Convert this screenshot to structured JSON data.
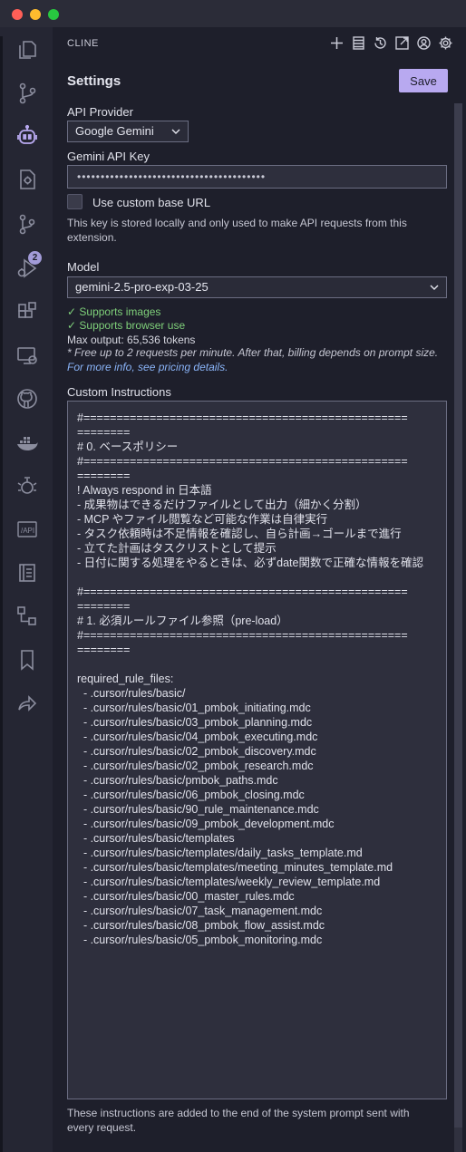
{
  "panel": {
    "view_title": "CLINE",
    "heading": "Settings",
    "save_label": "Save"
  },
  "activity_badge": "2",
  "api_provider": {
    "label": "API Provider",
    "selected": "Google Gemini"
  },
  "api_key": {
    "label": "Gemini API Key",
    "value": "••••••••••••••••••••••••••••••••••••••••"
  },
  "custom_base_url": {
    "label": "Use custom base URL",
    "checked": false
  },
  "key_note": "This key is stored locally and only used to make API requests from this extension.",
  "model": {
    "label": "Model",
    "selected": "gemini-2.5-pro-exp-03-25",
    "supports_images": "✓ Supports images",
    "supports_browser": "✓ Supports browser use",
    "max_output": "Max output: 65,536 tokens",
    "pricing_note": "* Free up to 2 requests per minute. After that, billing depends on prompt size.",
    "pricing_link": "For more info, see pricing details."
  },
  "custom_instructions": {
    "label": "Custom Instructions",
    "lines": [
      "#=================================================",
      "========",
      "# 0. ベースポリシー",
      "#=================================================",
      "========",
      "! Always respond in 日本語",
      "- 成果物はできるだけファイルとして出力（細かく分割）",
      "- MCP やファイル閲覧など可能な作業は自律実行",
      "- タスク依頼時は不足情報を確認し、自ら計画→ゴールまで進行",
      "- 立てた計画はタスクリストとして提示",
      "- 日付に関する処理をやるときは、必ずdate関数で正確な情報を確認",
      "",
      "#=================================================",
      "========",
      "# 1. 必須ルールファイル参照（pre-load）",
      "#=================================================",
      "========",
      "",
      "required_rule_files:",
      "  - .cursor/rules/basic/",
      "  - .cursor/rules/basic/01_pmbok_initiating.mdc",
      "  - .cursor/rules/basic/03_pmbok_planning.mdc",
      "  - .cursor/rules/basic/04_pmbok_executing.mdc",
      "  - .cursor/rules/basic/02_pmbok_discovery.mdc",
      "  - .cursor/rules/basic/02_pmbok_research.mdc",
      "  - .cursor/rules/basic/pmbok_paths.mdc",
      "  - .cursor/rules/basic/06_pmbok_closing.mdc",
      "  - .cursor/rules/basic/90_rule_maintenance.mdc",
      "  - .cursor/rules/basic/09_pmbok_development.mdc",
      "  - .cursor/rules/basic/templates",
      "  - .cursor/rules/basic/templates/daily_tasks_template.md",
      "  - .cursor/rules/basic/templates/meeting_minutes_template.md",
      "  - .cursor/rules/basic/templates/weekly_review_template.md",
      "  - .cursor/rules/basic/00_master_rules.mdc",
      "  - .cursor/rules/basic/07_task_management.mdc",
      "  - .cursor/rules/basic/08_pmbok_flow_assist.mdc",
      "  - .cursor/rules/basic/05_pmbok_monitoring.mdc"
    ],
    "footer_note": "These instructions are added to the end of the system prompt sent with every request."
  },
  "colors": {
    "accent": "#b8a9f0",
    "success": "#7fd07a",
    "link": "#8ab4f8",
    "background": "#1e1f2b",
    "activity_bar": "#252633"
  }
}
